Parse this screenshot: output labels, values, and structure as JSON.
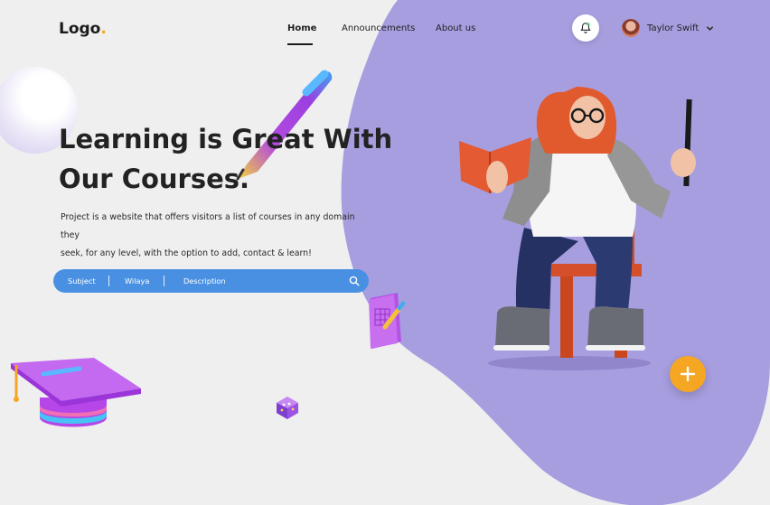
{
  "header": {
    "logo_text": "Logo",
    "logo_dot": ".",
    "nav": {
      "home": "Home",
      "announcements": "Announcements",
      "about": "About us"
    },
    "user": {
      "name": "Taylor Swift"
    }
  },
  "hero": {
    "title_line1": "Learning is Great With",
    "title_line2": "Our Courses.",
    "description_line1": "Project is a website that offers visitors a list of courses in any domain they",
    "description_line2": "seek, for any level, with the option to add, contact & learn!"
  },
  "search": {
    "subject": "Subject",
    "wilaya": "Wilaya",
    "description": "Description"
  },
  "colors": {
    "accent_orange": "#f5a623",
    "purple_blob": "#a79ee0",
    "search_blue": "#4a90e2",
    "background": "#efefef"
  },
  "icons": [
    "bell-icon",
    "chevron-down-icon",
    "search-icon",
    "plus-icon"
  ]
}
